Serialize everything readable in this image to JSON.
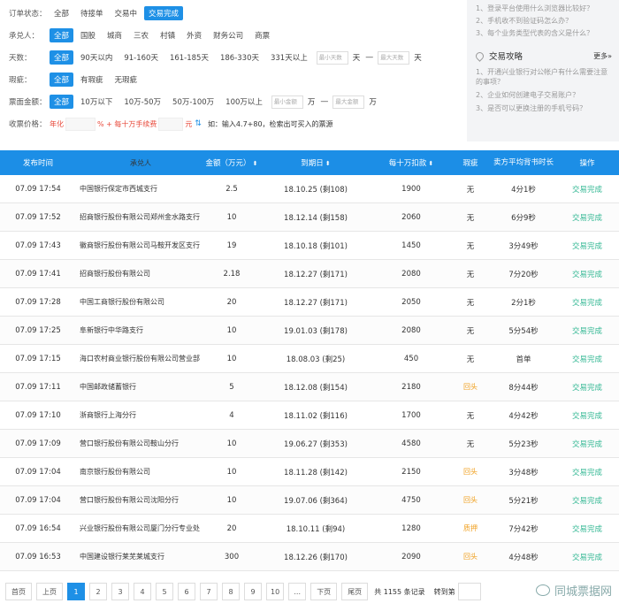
{
  "filters": {
    "order_status": {
      "label": "订单状态：",
      "options": [
        "全部",
        "待接单",
        "交易中",
        "交易完成"
      ],
      "active": 3
    },
    "acceptor": {
      "label": "承兑人：",
      "options": [
        "全部",
        "国股",
        "城商",
        "三农",
        "村镇",
        "外资",
        "财务公司",
        "商票"
      ],
      "active": 0
    },
    "days": {
      "label": "天数：",
      "options": [
        "全部",
        "90天以内",
        "91-160天",
        "161-185天",
        "186-330天",
        "331天以上"
      ],
      "active": 0,
      "min_placeholder": "最小天数",
      "max_placeholder": "最大天数",
      "unit": "天",
      "dash": "—"
    },
    "flaw": {
      "label": "瑕疵：",
      "options": [
        "全部",
        "有瑕疵",
        "无瑕疵"
      ],
      "active": 0
    },
    "amount": {
      "label": "票面金额：",
      "options": [
        "全部",
        "10万以下",
        "10万-50万",
        "50万-100万",
        "100万以上"
      ],
      "active": 0,
      "min_placeholder": "最小金额",
      "max_placeholder": "最大金额",
      "unit": "万",
      "dash": "—"
    },
    "price": {
      "label": "收票价格：",
      "annual": "年化",
      "plus": "% + 每十万手续费",
      "unit": "元",
      "hint": "如：输入4.7+80，检索出可买入的票源"
    }
  },
  "sidebar": {
    "faq": [
      "1、登录平台使用什么浏览器比较好？",
      "2、手机收不到验证码怎么办？",
      "3、每个业务类型代表的含义是什么？"
    ],
    "title": "交易攻略",
    "more": "更多»",
    "guides": [
      "1、开通兴业银行对公帐户有什么需要注意的事项？",
      "2、企业如何创建电子交易账户？",
      "3、是否可以更换注册的手机号码？"
    ]
  },
  "table": {
    "headers": [
      "发布时间",
      "承兑人",
      "金额（万元）",
      "到期日",
      "每十万扣款",
      "瑕疵",
      "卖方平均背书时长",
      "操作"
    ],
    "sort_arrow": "⬍",
    "rows": [
      [
        "07.09 17:54",
        "中国银行保定市西城支行",
        "2.5",
        "18.10.25 (剩108)",
        "1900",
        "无",
        "4分1秒",
        "交易完成"
      ],
      [
        "07.09 17:52",
        "招商银行股份有限公司郑州金水路支行",
        "10",
        "18.12.14 (剩158)",
        "2060",
        "无",
        "6分9秒",
        "交易完成"
      ],
      [
        "07.09 17:43",
        "徽商银行股份有限公司马鞍开发区支行",
        "19",
        "18.10.18 (剩101)",
        "1450",
        "无",
        "3分49秒",
        "交易完成"
      ],
      [
        "07.09 17:41",
        "招商银行股份有限公司",
        "2.18",
        "18.12.27 (剩171)",
        "2080",
        "无",
        "7分20秒",
        "交易完成"
      ],
      [
        "07.09 17:28",
        "中国工商银行股份有限公司",
        "20",
        "18.12.27 (剩171)",
        "2050",
        "无",
        "2分1秒",
        "交易完成"
      ],
      [
        "07.09 17:25",
        "阜新银行中华路支行",
        "10",
        "19.01.03 (剩178)",
        "2080",
        "无",
        "5分54秒",
        "交易完成"
      ],
      [
        "07.09 17:15",
        "海口农村商业银行股份有限公司营业部",
        "10",
        "18.08.03 (剩25)",
        "450",
        "无",
        "首单",
        "交易完成"
      ],
      [
        "07.09 17:11",
        "中国邮政储蓄银行",
        "5",
        "18.12.08 (剩154)",
        "2180",
        "回头",
        "8分44秒",
        "交易完成"
      ],
      [
        "07.09 17:10",
        "浙商银行上海分行",
        "4",
        "18.11.02 (剩116)",
        "1700",
        "无",
        "4分42秒",
        "交易完成"
      ],
      [
        "07.09 17:09",
        "营口银行股份有限公司鞍山分行",
        "10",
        "19.06.27 (剩353)",
        "4580",
        "无",
        "5分23秒",
        "交易完成"
      ],
      [
        "07.09 17:04",
        "南京银行股份有限公司",
        "10",
        "18.11.28 (剩142)",
        "2150",
        "回头",
        "3分48秒",
        "交易完成"
      ],
      [
        "07.09 17:04",
        "营口银行股份有限公司沈阳分行",
        "10",
        "19.07.06 (剩364)",
        "4750",
        "回头",
        "5分21秒",
        "交易完成"
      ],
      [
        "07.09 16:54",
        "兴业银行股份有限公司厦门分行专业处",
        "20",
        "18.10.11 (剩94)",
        "1280",
        "质押",
        "7分42秒",
        "交易完成"
      ],
      [
        "07.09 16:53",
        "中国建设银行莱芜莱城支行",
        "300",
        "18.12.26 (剩170)",
        "2090",
        "回头",
        "4分48秒",
        "交易完成"
      ]
    ]
  },
  "pager": {
    "first": "首页",
    "prev": "上页",
    "pages": [
      "1",
      "2",
      "3",
      "4",
      "5",
      "6",
      "7",
      "8",
      "9",
      "10",
      "..."
    ],
    "next": "下页",
    "last": "尾页",
    "total": "共 1155 条记录",
    "goto": "转到第",
    "active": 0
  },
  "watermark": "同城票据网",
  "colors": {
    "accent": "#1e90e6",
    "header": "#1c8ee6",
    "done": "#34b894",
    "tag": "#f0a020",
    "red": "#e84b3c"
  }
}
